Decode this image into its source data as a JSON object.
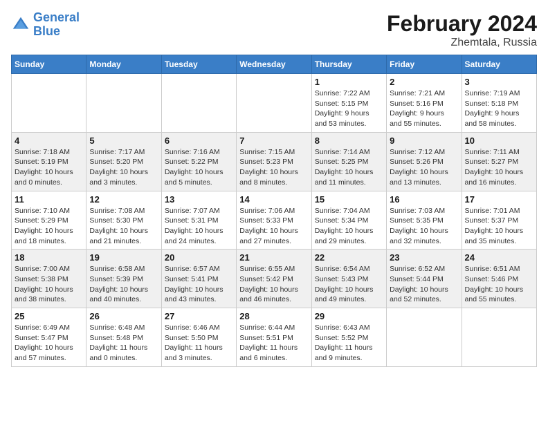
{
  "header": {
    "logo_line1": "General",
    "logo_line2": "Blue",
    "month_title": "February 2024",
    "location": "Zhemtala, Russia"
  },
  "weekdays": [
    "Sunday",
    "Monday",
    "Tuesday",
    "Wednesday",
    "Thursday",
    "Friday",
    "Saturday"
  ],
  "weeks": [
    [
      {
        "day": "",
        "info": ""
      },
      {
        "day": "",
        "info": ""
      },
      {
        "day": "",
        "info": ""
      },
      {
        "day": "",
        "info": ""
      },
      {
        "day": "1",
        "info": "Sunrise: 7:22 AM\nSunset: 5:15 PM\nDaylight: 9 hours\nand 53 minutes."
      },
      {
        "day": "2",
        "info": "Sunrise: 7:21 AM\nSunset: 5:16 PM\nDaylight: 9 hours\nand 55 minutes."
      },
      {
        "day": "3",
        "info": "Sunrise: 7:19 AM\nSunset: 5:18 PM\nDaylight: 9 hours\nand 58 minutes."
      }
    ],
    [
      {
        "day": "4",
        "info": "Sunrise: 7:18 AM\nSunset: 5:19 PM\nDaylight: 10 hours\nand 0 minutes."
      },
      {
        "day": "5",
        "info": "Sunrise: 7:17 AM\nSunset: 5:20 PM\nDaylight: 10 hours\nand 3 minutes."
      },
      {
        "day": "6",
        "info": "Sunrise: 7:16 AM\nSunset: 5:22 PM\nDaylight: 10 hours\nand 5 minutes."
      },
      {
        "day": "7",
        "info": "Sunrise: 7:15 AM\nSunset: 5:23 PM\nDaylight: 10 hours\nand 8 minutes."
      },
      {
        "day": "8",
        "info": "Sunrise: 7:14 AM\nSunset: 5:25 PM\nDaylight: 10 hours\nand 11 minutes."
      },
      {
        "day": "9",
        "info": "Sunrise: 7:12 AM\nSunset: 5:26 PM\nDaylight: 10 hours\nand 13 minutes."
      },
      {
        "day": "10",
        "info": "Sunrise: 7:11 AM\nSunset: 5:27 PM\nDaylight: 10 hours\nand 16 minutes."
      }
    ],
    [
      {
        "day": "11",
        "info": "Sunrise: 7:10 AM\nSunset: 5:29 PM\nDaylight: 10 hours\nand 18 minutes."
      },
      {
        "day": "12",
        "info": "Sunrise: 7:08 AM\nSunset: 5:30 PM\nDaylight: 10 hours\nand 21 minutes."
      },
      {
        "day": "13",
        "info": "Sunrise: 7:07 AM\nSunset: 5:31 PM\nDaylight: 10 hours\nand 24 minutes."
      },
      {
        "day": "14",
        "info": "Sunrise: 7:06 AM\nSunset: 5:33 PM\nDaylight: 10 hours\nand 27 minutes."
      },
      {
        "day": "15",
        "info": "Sunrise: 7:04 AM\nSunset: 5:34 PM\nDaylight: 10 hours\nand 29 minutes."
      },
      {
        "day": "16",
        "info": "Sunrise: 7:03 AM\nSunset: 5:35 PM\nDaylight: 10 hours\nand 32 minutes."
      },
      {
        "day": "17",
        "info": "Sunrise: 7:01 AM\nSunset: 5:37 PM\nDaylight: 10 hours\nand 35 minutes."
      }
    ],
    [
      {
        "day": "18",
        "info": "Sunrise: 7:00 AM\nSunset: 5:38 PM\nDaylight: 10 hours\nand 38 minutes."
      },
      {
        "day": "19",
        "info": "Sunrise: 6:58 AM\nSunset: 5:39 PM\nDaylight: 10 hours\nand 40 minutes."
      },
      {
        "day": "20",
        "info": "Sunrise: 6:57 AM\nSunset: 5:41 PM\nDaylight: 10 hours\nand 43 minutes."
      },
      {
        "day": "21",
        "info": "Sunrise: 6:55 AM\nSunset: 5:42 PM\nDaylight: 10 hours\nand 46 minutes."
      },
      {
        "day": "22",
        "info": "Sunrise: 6:54 AM\nSunset: 5:43 PM\nDaylight: 10 hours\nand 49 minutes."
      },
      {
        "day": "23",
        "info": "Sunrise: 6:52 AM\nSunset: 5:44 PM\nDaylight: 10 hours\nand 52 minutes."
      },
      {
        "day": "24",
        "info": "Sunrise: 6:51 AM\nSunset: 5:46 PM\nDaylight: 10 hours\nand 55 minutes."
      }
    ],
    [
      {
        "day": "25",
        "info": "Sunrise: 6:49 AM\nSunset: 5:47 PM\nDaylight: 10 hours\nand 57 minutes."
      },
      {
        "day": "26",
        "info": "Sunrise: 6:48 AM\nSunset: 5:48 PM\nDaylight: 11 hours\nand 0 minutes."
      },
      {
        "day": "27",
        "info": "Sunrise: 6:46 AM\nSunset: 5:50 PM\nDaylight: 11 hours\nand 3 minutes."
      },
      {
        "day": "28",
        "info": "Sunrise: 6:44 AM\nSunset: 5:51 PM\nDaylight: 11 hours\nand 6 minutes."
      },
      {
        "day": "29",
        "info": "Sunrise: 6:43 AM\nSunset: 5:52 PM\nDaylight: 11 hours\nand 9 minutes."
      },
      {
        "day": "",
        "info": ""
      },
      {
        "day": "",
        "info": ""
      }
    ]
  ]
}
